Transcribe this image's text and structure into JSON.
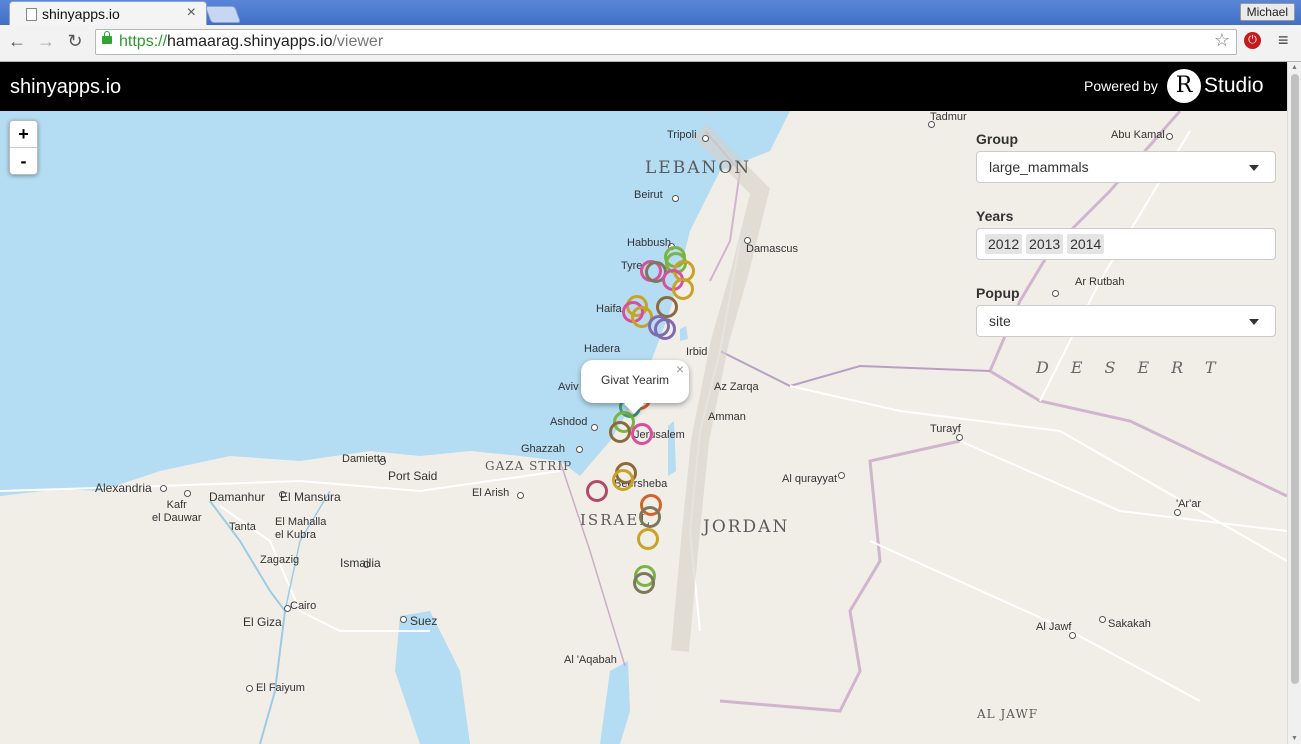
{
  "browser": {
    "tab_title": "shinyapps.io",
    "tab_close": "×",
    "profile_name": "Michael",
    "url_scheme": "https://",
    "url_host": "hamaarag.shinyapps.io",
    "url_path": "/viewer",
    "back_glyph": "←",
    "forward_glyph": "→",
    "reload_glyph": "↻",
    "star_glyph": "☆",
    "menu_glyph": "≡",
    "ext_glyph": "⏻"
  },
  "header": {
    "title": "shinyapps.io",
    "powered_by": "Powered by",
    "r_letter": "R",
    "studio": "Studio"
  },
  "zoom": {
    "in": "+",
    "out": "-"
  },
  "controls": {
    "group": {
      "label": "Group",
      "value": "large_mammals"
    },
    "years": {
      "label": "Years",
      "values": [
        "2012",
        "2013",
        "2014"
      ]
    },
    "popup": {
      "label": "Popup",
      "value": "site"
    }
  },
  "map_popup": {
    "text": "Givat Yearim",
    "close": "×"
  },
  "map_labels": {
    "countries": {
      "lebanon": "LEBANON",
      "jordan": "JORDAN",
      "israel": "ISRAEL",
      "gaza_strip": "GAZA STRIP",
      "desert": "DESERT",
      "al_jawf_region": "AL JAWF"
    },
    "cities": {
      "tripoli": "Tripoli",
      "beirut": "Beirut",
      "damascus": "Damascus",
      "tadmur": "Tadmur",
      "abu_kamal": "Abu Kamal",
      "habbush": "Habbush",
      "tyre": "Tyre",
      "haifa": "Haifa",
      "hadera": "Hadera",
      "irbid": "Irbid",
      "aviv": "Aviv",
      "az_zarqa": "Az Zarqa",
      "amman": "Amman",
      "ashdod": "Ashdod",
      "jerusalem": "Jerusalem",
      "ghazzah": "Ghazzah",
      "beersheba": "Beersheba",
      "el_arish": "El Arish",
      "damietta": "Damietta",
      "port_said": "Port Said",
      "alexandria": "Alexandria",
      "kafr_el_dauwar": "Kafr\nel Dauwar",
      "damanhur": "Damanhur",
      "el_mansura": "El Mansura",
      "tanta": "Tanta",
      "el_mahalla": "El Mahalla\nel Kubra",
      "zagazig": "Zagazig",
      "ismailia": "Ismailia",
      "cairo": "Cairo",
      "el_giza": "El Giza",
      "suez": "Suez",
      "el_faiyum": "El Faiyum",
      "al_aqabah": "Al 'Aqabah",
      "al_qurayyat": "Al qurayyat",
      "turayf": "Turayf",
      "ar_rutbah": "Ar Rutbah",
      "arar": "'Ar'ar",
      "al_jawf": "Al Jawf",
      "sakakah": "Sakakah"
    }
  },
  "colors": {
    "sea": "#b4dcf2",
    "land": "#f1eee8",
    "header_bg": "#000000",
    "marker_palette": [
      "#7cb342",
      "#d84f9c",
      "#c9a227",
      "#7e6bb0",
      "#d4632a",
      "#7a7a5a",
      "#b24a6a",
      "#3aa07a",
      "#8b6a3e"
    ]
  },
  "markers": [
    {
      "lat": 33.35,
      "lon": 35.6,
      "color": "#7cb342"
    },
    {
      "lat": 33.28,
      "lon": 35.62,
      "color": "#7cb342"
    },
    {
      "lat": 33.2,
      "lon": 35.3,
      "color": "#d84f9c"
    },
    {
      "lat": 33.18,
      "lon": 35.36,
      "color": "#7a7a5a"
    },
    {
      "lat": 33.2,
      "lon": 35.72,
      "color": "#c9a227"
    },
    {
      "lat": 33.1,
      "lon": 35.58,
      "color": "#d84f9c"
    },
    {
      "lat": 33.0,
      "lon": 35.7,
      "color": "#c9a227"
    },
    {
      "lat": 32.82,
      "lon": 35.12,
      "color": "#c9a227"
    },
    {
      "lat": 32.75,
      "lon": 35.06,
      "color": "#d84f9c"
    },
    {
      "lat": 32.7,
      "lon": 35.18,
      "color": "#c9a227"
    },
    {
      "lat": 32.8,
      "lon": 35.5,
      "color": "#8b6a3e"
    },
    {
      "lat": 32.6,
      "lon": 35.4,
      "color": "#7e6bb0"
    },
    {
      "lat": 32.57,
      "lon": 35.48,
      "color": "#7e6bb0"
    },
    {
      "lat": 31.8,
      "lon": 35.16,
      "color": "#d4632a"
    },
    {
      "lat": 31.72,
      "lon": 35.03,
      "color": "#3aa07a"
    },
    {
      "lat": 31.55,
      "lon": 34.95,
      "color": "#7cb342"
    },
    {
      "lat": 31.45,
      "lon": 34.9,
      "color": "#8b6a3e"
    },
    {
      "lat": 31.42,
      "lon": 35.18,
      "color": "#d84f9c"
    },
    {
      "lat": 31.0,
      "lon": 34.98,
      "color": "#8b6a3e"
    },
    {
      "lat": 30.92,
      "lon": 34.93,
      "color": "#c9a227"
    },
    {
      "lat": 30.8,
      "lon": 34.6,
      "color": "#b24a6a"
    },
    {
      "lat": 30.65,
      "lon": 35.3,
      "color": "#d4632a"
    },
    {
      "lat": 30.52,
      "lon": 35.28,
      "color": "#7a7a5a"
    },
    {
      "lat": 30.28,
      "lon": 35.25,
      "color": "#c9a227"
    },
    {
      "lat": 29.88,
      "lon": 35.22,
      "color": "#7cb342"
    },
    {
      "lat": 29.8,
      "lon": 35.2,
      "color": "#7a7a5a"
    }
  ]
}
